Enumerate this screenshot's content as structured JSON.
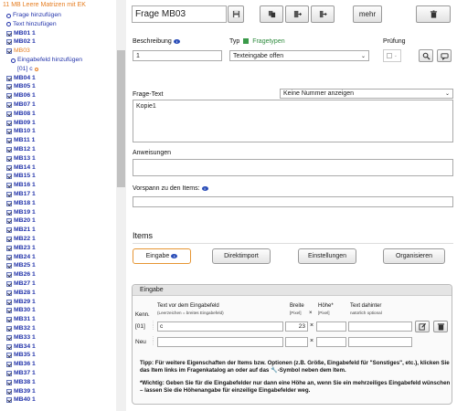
{
  "sidebar": {
    "root_label": "11 MB Leere Matrizen mit EK",
    "actions": [
      "Frage hinzufügen",
      "Text hinzufügen"
    ],
    "items_before": [
      "MB01 1",
      "MB02 1"
    ],
    "active": "MB03",
    "active_sub": "Eingabefeld hinzufügen",
    "active_sub2": "[01] c",
    "items_after": [
      "MB04 1",
      "MB05 1",
      "MB06 1",
      "MB07 1",
      "MB08 1",
      "MB09 1",
      "MB10 1",
      "MB11 1",
      "MB12 1",
      "MB13 1",
      "MB14 1",
      "MB15 1",
      "MB16 1",
      "MB17 1",
      "MB18 1",
      "MB19 1",
      "MB20 1",
      "MB21 1",
      "MB22 1",
      "MB23 1",
      "MB24 1",
      "MB25 1",
      "MB26 1",
      "MB27 1",
      "MB28 1",
      "MB29 1",
      "MB30 1",
      "MB31 1",
      "MB32 1",
      "MB33 1",
      "MB34 1",
      "MB35 1",
      "MB36 1",
      "MB37 1",
      "MB38 1",
      "MB39 1",
      "MB40 1"
    ]
  },
  "toolbar": {
    "title": "Frage MB03",
    "more_label": "mehr"
  },
  "form": {
    "beschreibung_label": "Beschreibung",
    "beschreibung_value": "1",
    "typ_label": "Typ",
    "fragetypen_link": "Fragetypen",
    "typ_value": "Texteingabe offen",
    "pruefung_label": "Prüfung",
    "fragetext_label": "Frage-Text",
    "nummer_select": "Keine Nummer anzeigen",
    "fragetext_value": "Kopie1",
    "anweisungen_label": "Anweisungen",
    "vorspann_label": "Vorspann zu den Items:"
  },
  "items": {
    "heading": "Items",
    "tabs": [
      "Eingabe",
      "Direktimport",
      "Einstellungen",
      "Organisieren"
    ],
    "active_tab": "Eingabe"
  },
  "eingabe": {
    "panel_title": "Eingabe",
    "col_kenn": "Kenn.",
    "col_text": "Text vor dem Eingabefeld",
    "col_text_sub": "(Leerzeichen = breites Eingabefeld)",
    "col_breite": "Breite",
    "col_breite_sub": "[Pixel]",
    "col_x": "×",
    "col_hoehe": "Höhe*",
    "col_hoehe_sub": "[Pixel]",
    "col_dahinter": "Text dahinter",
    "col_dahinter_sub": "natürlich optional",
    "rows": [
      {
        "kenn": "[01]",
        "text": "c",
        "breite": "23",
        "x": "×",
        "hoehe": "",
        "dahinter": ""
      },
      {
        "kenn": "Neu",
        "text": "",
        "breite": "",
        "x": "×",
        "hoehe": "",
        "dahinter": ""
      }
    ],
    "tipp": "Tipp: Für weitere Eigenschaften der Items bzw. Optionen (z.B. Größe, Eingabefeld für \"Sonstiges\", etc.), klicken Sie das Item links im Fragenkatalog an oder auf das 🔧-Symbol neben dem Item.",
    "wichtig": "*Wichtig: Geben Sie für die Eingabefelder nur dann eine Höhe an, wenn Sie ein mehrzeiliges Eingabefeld wünschen – lassen Sie die Höhenangabe für einzeilige Eingabefelder weg."
  },
  "colors": {
    "link_blue": "#2233aa",
    "active_orange": "#e67e22",
    "tab_active_border": "#e69533",
    "green": "#2e8b3d"
  }
}
